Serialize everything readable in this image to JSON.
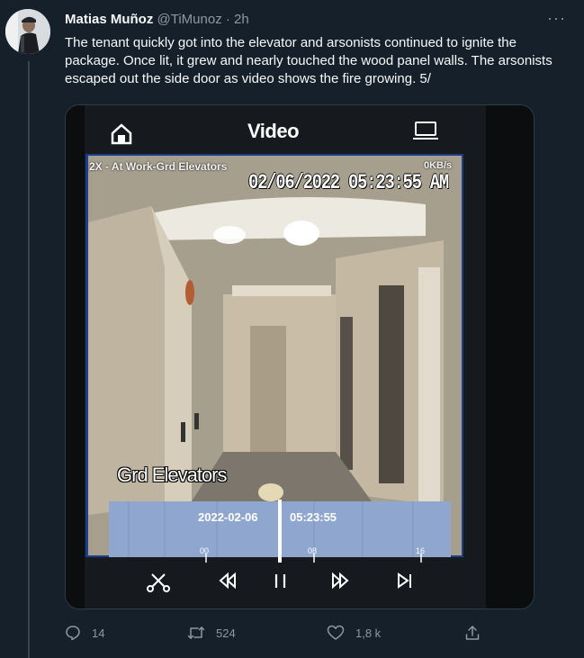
{
  "tweet": {
    "author_name": "Matias Muñoz",
    "handle": "@TiMunoz",
    "separator": "·",
    "time": "2h",
    "more_icon": "more-dots-icon",
    "text": "The tenant quickly got into the elevator and arsonists continued to ignite the package. Once lit, it grew and nearly touched the wood panel walls. The arsonists escaped out the side door as video shows the fire growing. 5/"
  },
  "video_app": {
    "title": "Video",
    "home_icon": "home-icon",
    "hd_icon": "hd-icon",
    "camera_label": "2X - At Work-Grd Elevators",
    "rate": "0KB/s",
    "timestamp": "02/06/2022 05:23:55 AM",
    "camera_name": "Grd Elevators",
    "timeline": {
      "date": "2022-02-06",
      "time": "05:23:55",
      "ticks": [
        "00",
        "08",
        "16"
      ]
    },
    "controls": [
      "scissors-icon",
      "rewind-icon",
      "pause-icon",
      "fast-forward-icon",
      "skip-end-icon"
    ]
  },
  "actions": {
    "replies": "14",
    "retweets": "524",
    "likes": "1,8 k"
  },
  "colors": {
    "background": "#15202b",
    "secondary_text": "#8b98a5",
    "timeline_blue": "#8fa6ce"
  }
}
